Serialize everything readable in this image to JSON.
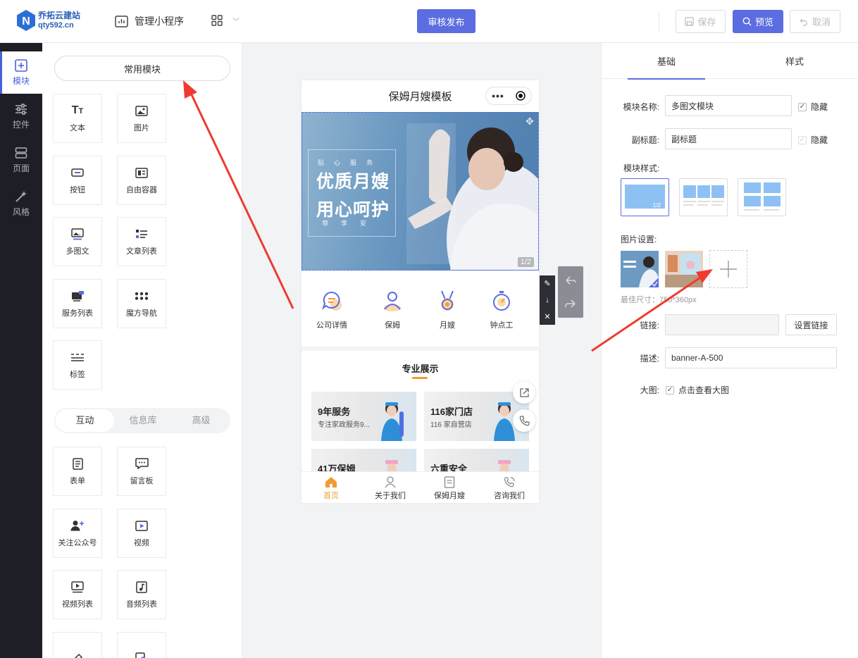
{
  "header": {
    "logo_title": "乔拓云建站",
    "logo_domain": "qty592.cn",
    "manage_label": "管理小程序",
    "publish_label": "审核发布",
    "save_label": "保存",
    "preview_label": "预览",
    "cancel_label": "取消"
  },
  "left_nav": {
    "items": [
      {
        "label": "模块",
        "icon": "plus-square-icon"
      },
      {
        "label": "控件",
        "icon": "sliders-icon"
      },
      {
        "label": "页面",
        "icon": "pages-icon"
      },
      {
        "label": "风格",
        "icon": "magic-wand-icon"
      }
    ]
  },
  "modules": {
    "common_label": "常用模块",
    "common": [
      {
        "label": "文本"
      },
      {
        "label": "图片"
      },
      {
        "label": "按钮"
      },
      {
        "label": "自由容器"
      },
      {
        "label": "多图文"
      },
      {
        "label": "文章列表"
      },
      {
        "label": "服务列表"
      },
      {
        "label": "魔方导航"
      },
      {
        "label": "标签"
      }
    ],
    "tabs": [
      "互动",
      "信息库",
      "高级"
    ],
    "interactive": [
      {
        "label": "表单"
      },
      {
        "label": "留言板"
      },
      {
        "label": "关注公众号"
      },
      {
        "label": "视频"
      },
      {
        "label": "视频列表"
      },
      {
        "label": "音频列表"
      }
    ]
  },
  "phone": {
    "title": "保姆月嫂模板",
    "banner": {
      "small1": "贴心服务",
      "big1": "优质月嫂",
      "big2": "用心呵护",
      "small2": "尊享安",
      "counter": "1/2"
    },
    "nav": [
      {
        "label": "公司详情"
      },
      {
        "label": "保姆"
      },
      {
        "label": "月嫂"
      },
      {
        "label": "钟点工"
      }
    ],
    "section_title": "专业展示",
    "cards": [
      {
        "title": "9年服务",
        "sub": "专注家政服务9..."
      },
      {
        "title": "116家门店",
        "sub": "116 家自营店"
      },
      {
        "title": "41万保姆",
        "sub": ""
      },
      {
        "title": "六重安全",
        "sub": ""
      }
    ],
    "tabbar": [
      {
        "label": "首页"
      },
      {
        "label": "关于我们"
      },
      {
        "label": "保姆月嫂"
      },
      {
        "label": "咨询我们"
      }
    ]
  },
  "right_panel": {
    "tab_basic": "基础",
    "tab_style": "样式",
    "module_name_label": "模块名称:",
    "module_name_value": "多图文模块",
    "hide_label": "隐藏",
    "subtitle_label": "副标题:",
    "subtitle_value": "副标题",
    "hide_label2": "隐藏",
    "style_label": "模块样式:",
    "style_badge": "1/2",
    "image_label": "图片设置:",
    "image_hint": "最佳尺寸：750*360px",
    "link_label": "链接:",
    "set_link_label": "设置链接",
    "desc_label": "描述:",
    "desc_value": "banner-A-500",
    "bigimg_label": "大图:",
    "bigimg_option": "点击查看大图"
  },
  "colors": {
    "accent": "#5b6de0",
    "orange": "#f39a33",
    "nav_dark": "#1e1f26",
    "arrow": "#ee3b2f"
  }
}
